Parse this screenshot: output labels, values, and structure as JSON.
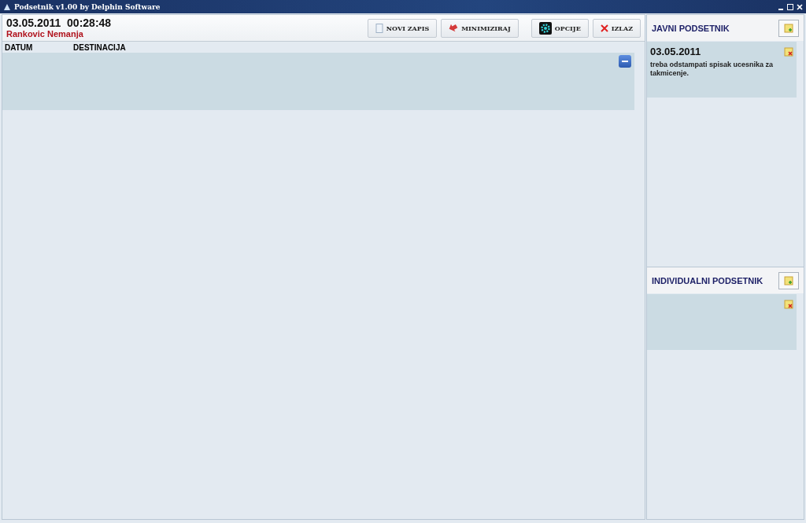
{
  "window": {
    "title": "Podsetnik v1.00 by Delphin Software"
  },
  "header": {
    "datetime": "03.05.2011  00:28:48",
    "user": "Rankovic Nemanja"
  },
  "toolbar": [
    {
      "label": "NOVI ZAPIS",
      "kind": "new"
    },
    {
      "label": "MINIMIZIRAJ",
      "kind": "minimize"
    },
    {
      "label": "OPCIJE",
      "kind": "options"
    },
    {
      "label": "IZLAZ",
      "kind": "exit"
    }
  ],
  "table": {
    "columns": [
      "DATUM",
      "DESTINACIJA"
    ],
    "rows": [
      {
        "expanded": true
      }
    ]
  },
  "sidebar": [
    {
      "title": "JAVNI PODSETNIK",
      "notes": [
        {
          "date": "03.05.2011",
          "text": "treba odstampati spisak ucesnika za takmicenje."
        }
      ]
    },
    {
      "title": "INDIVIDUALNI PODSETNIK"
    }
  ]
}
